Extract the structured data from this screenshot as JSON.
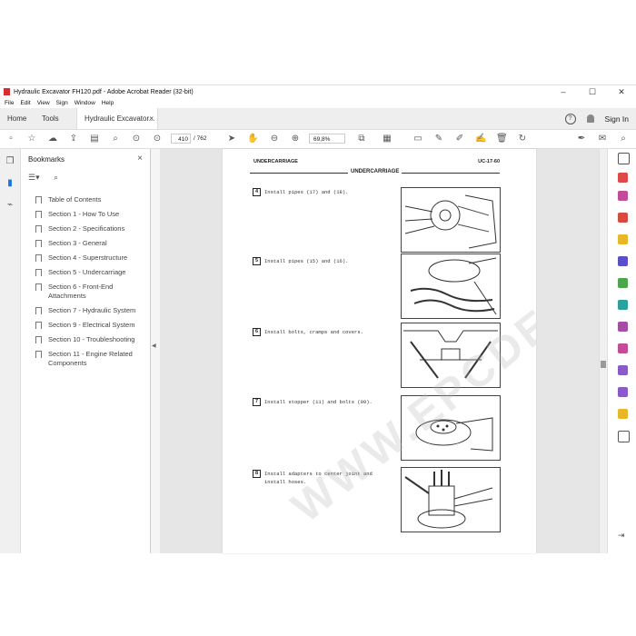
{
  "window": {
    "title": "Hydraulic Excavator FH120.pdf - Adobe Acrobat Reader (32-bit)",
    "controls": {
      "minimize": "–",
      "maximize": "☐",
      "close": "✕"
    }
  },
  "menu": [
    "File",
    "Edit",
    "View",
    "Sign",
    "Window",
    "Help"
  ],
  "tabs": {
    "home": "Home",
    "tools": "Tools",
    "doc": "Hydraulic Excavator...",
    "close": "×"
  },
  "account": {
    "help": "?",
    "sign_in": "Sign In"
  },
  "toolbar": {
    "page_current": "410",
    "page_total": "/ 762",
    "zoom": "69,8%"
  },
  "bookmarks": {
    "header": "Bookmarks",
    "close": "×",
    "items": [
      {
        "label": "Table of Contents"
      },
      {
        "label": "Section 1 - How To Use"
      },
      {
        "label": "Section 2 - Specifications"
      },
      {
        "label": "Section 3 - General"
      },
      {
        "label": "Section 4 - Superstructure"
      },
      {
        "label": "Section 5 - Undercarriage"
      },
      {
        "label": "Section 6 - Front-End Attachments"
      },
      {
        "label": "Section 7 - Hydraulic System"
      },
      {
        "label": "Section 9 - Electrical System"
      },
      {
        "label": "Section 10 - Troubleshooting"
      },
      {
        "label": "Section 11 - Engine Related Components"
      }
    ]
  },
  "document": {
    "header_left": "UNDERCARRIAGE",
    "header_center": "UNDERCARRIAGE",
    "header_right": "UC-17-60",
    "steps": [
      {
        "num": "4",
        "text": "Install pipes (17) and (18)."
      },
      {
        "num": "5",
        "text": "Install pipes (15) and (16)."
      },
      {
        "num": "6",
        "text": "Install bolts, cramps and covers."
      },
      {
        "num": "7",
        "text": "Install stopper (11) and bolts (09)."
      },
      {
        "num": "8",
        "text": "Install adapters to center joint and install hoses."
      }
    ],
    "watermark": "WWW.EPCDEPOT.COM"
  }
}
